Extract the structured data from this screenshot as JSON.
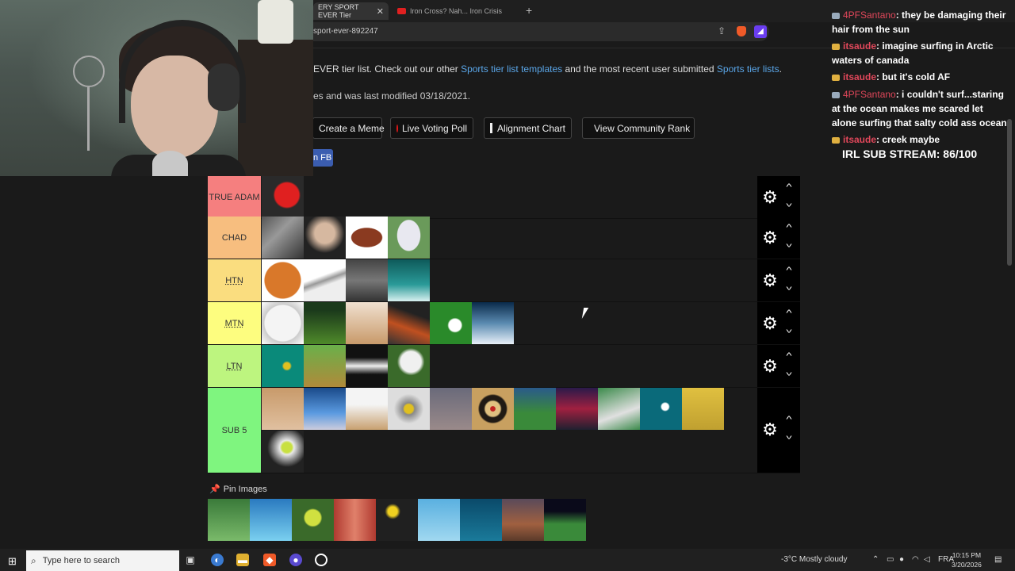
{
  "browser": {
    "active_tab_title": "ERY SPORT EVER Tier",
    "other_tab_title": "Iron Cross? Nah... Iron Crisis",
    "url": "sport-ever-892247"
  },
  "page": {
    "desc_prefix": "EVER tier list. Check out our other ",
    "desc_link1": "Sports tier list templates",
    "desc_mid": " and the most recent user submitted ",
    "desc_link2": "Sports tier lists",
    "desc_end": ".",
    "modified": "es and was last modified 03/18/2021.",
    "buttons": {
      "meme": "Create a Meme",
      "poll": "Live Voting Poll",
      "alignment": "Alignment Chart",
      "community": "View Community Rank"
    },
    "fb": "n FB",
    "pin_images": "Pin Images"
  },
  "tiers": [
    {
      "label": "TRUE ADAM",
      "color": "#f57f7f",
      "items": 1
    },
    {
      "label": "CHAD",
      "color": "#f7be7f",
      "items": 4
    },
    {
      "label": "HTN",
      "color": "#fadd7f",
      "items": 4
    },
    {
      "label": "MTN",
      "color": "#fdfd7f",
      "items": 6
    },
    {
      "label": "LTN",
      "color": "#bdf57f",
      "items": 4
    },
    {
      "label": "SUB 5",
      "color": "#7ff57f",
      "items": 12
    }
  ],
  "chat": {
    "messages": [
      {
        "user": "4PFSantano",
        "text": ": they be damaging their hair from the sun"
      },
      {
        "user": "itsaude",
        "text": ": imagine surfing in Arctic waters of canada"
      },
      {
        "user": "itsaude",
        "text": ": but it's cold AF"
      },
      {
        "user": "4PFSantano",
        "text": ": i couldn't surf...staring at the ocean makes me scared let alone surfing that salty cold ass ocean"
      },
      {
        "user": "itsaude",
        "text": ": creek maybe"
      }
    ],
    "substream": "IRL SUB STREAM: 86/100"
  },
  "taskbar": {
    "search_placeholder": "Type here to search",
    "weather": "-3°C  Mostly cloudy",
    "lang": "FRA",
    "time": "10:15 PM",
    "date": "3/20/2026"
  }
}
